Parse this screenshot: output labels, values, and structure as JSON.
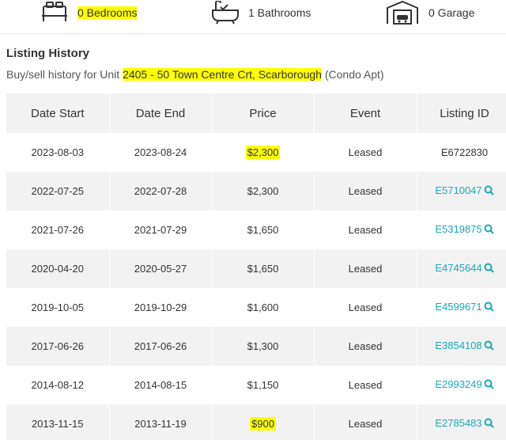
{
  "features": {
    "bedrooms": "0 Bedrooms",
    "bathrooms": "1 Bathrooms",
    "garage": "0 Garage"
  },
  "history": {
    "title": "Listing History",
    "subtitle_prefix": "Buy/sell history for Unit ",
    "unit": "2405 - 50 Town Centre Crt, Scarborough",
    "subtitle_suffix": " (Condo Apt)",
    "columns": [
      "Date Start",
      "Date End",
      "Price",
      "Event",
      "Listing ID"
    ],
    "rows": [
      {
        "start": "2023-08-03",
        "end": "2023-08-24",
        "price": "$2,300",
        "event": "Leased",
        "listing_id": "E6722830"
      },
      {
        "start": "2022-07-25",
        "end": "2022-07-28",
        "price": "$2,300",
        "event": "Leased",
        "listing_id": "E5710047"
      },
      {
        "start": "2021-07-26",
        "end": "2021-07-29",
        "price": "$1,650",
        "event": "Leased",
        "listing_id": "E5319875"
      },
      {
        "start": "2020-04-20",
        "end": "2020-05-27",
        "price": "$1,650",
        "event": "Leased",
        "listing_id": "E4745644"
      },
      {
        "start": "2019-10-05",
        "end": "2019-10-29",
        "price": "$1,600",
        "event": "Leased",
        "listing_id": "E4599671"
      },
      {
        "start": "2017-06-26",
        "end": "2017-06-26",
        "price": "$1,300",
        "event": "Leased",
        "listing_id": "E3854108"
      },
      {
        "start": "2014-08-12",
        "end": "2014-08-15",
        "price": "$1,150",
        "event": "Leased",
        "listing_id": "E2993249"
      },
      {
        "start": "2013-11-15",
        "end": "2013-11-19",
        "price": "$900",
        "event": "Leased",
        "listing_id": "E2785483"
      }
    ]
  },
  "icons": {
    "bed": "bed-icon",
    "bath": "bathtub-icon",
    "garage": "garage-icon",
    "search": "search-icon"
  },
  "colors": {
    "link": "#1aa7b8",
    "highlight": "#ffff00",
    "stripe": "#f2f2f2"
  }
}
